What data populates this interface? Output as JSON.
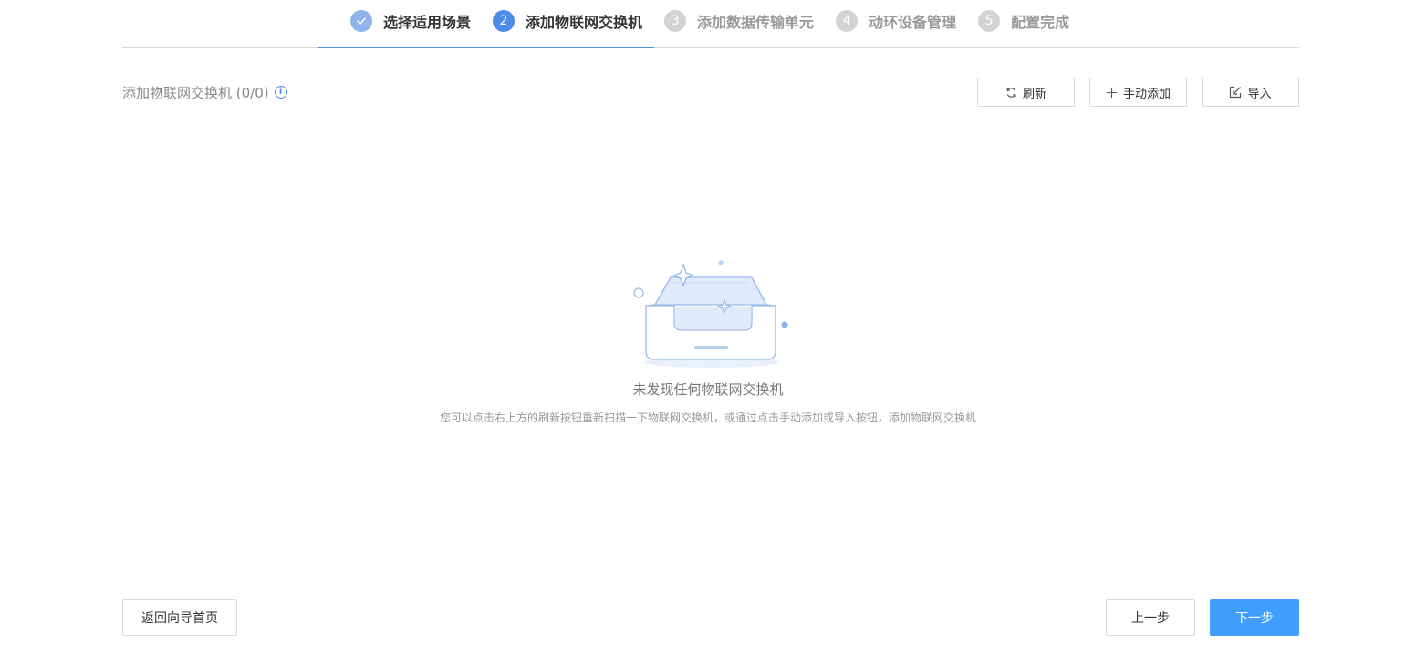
{
  "steps": [
    {
      "num": "1",
      "label": "选择适用场景",
      "state": "done"
    },
    {
      "num": "2",
      "label": "添加物联网交换机",
      "state": "active"
    },
    {
      "num": "3",
      "label": "添加数据传输单元",
      "state": "todo"
    },
    {
      "num": "4",
      "label": "动环设备管理",
      "state": "todo"
    },
    {
      "num": "5",
      "label": "配置完成",
      "state": "todo"
    }
  ],
  "section": {
    "title": "添加物联网交换机 (0/0)",
    "info_icon": "info-icon"
  },
  "toolbar": {
    "refresh_label": "刷新",
    "manual_add_label": "手动添加",
    "import_label": "导入"
  },
  "empty": {
    "title": "未发现任何物联网交换机",
    "description": "您可以点击右上方的刷新按钮重新扫描一下物联网交换机，或通过点击手动添加或导入按钮，添加物联网交换机"
  },
  "footer": {
    "home_label": "返回向导首页",
    "prev_label": "上一步",
    "next_label": "下一步"
  },
  "colors": {
    "accent": "#4a8ce8",
    "primary_button": "#409eff",
    "step_done": "#8fb3ea",
    "step_todo": "#d3d3d3"
  }
}
